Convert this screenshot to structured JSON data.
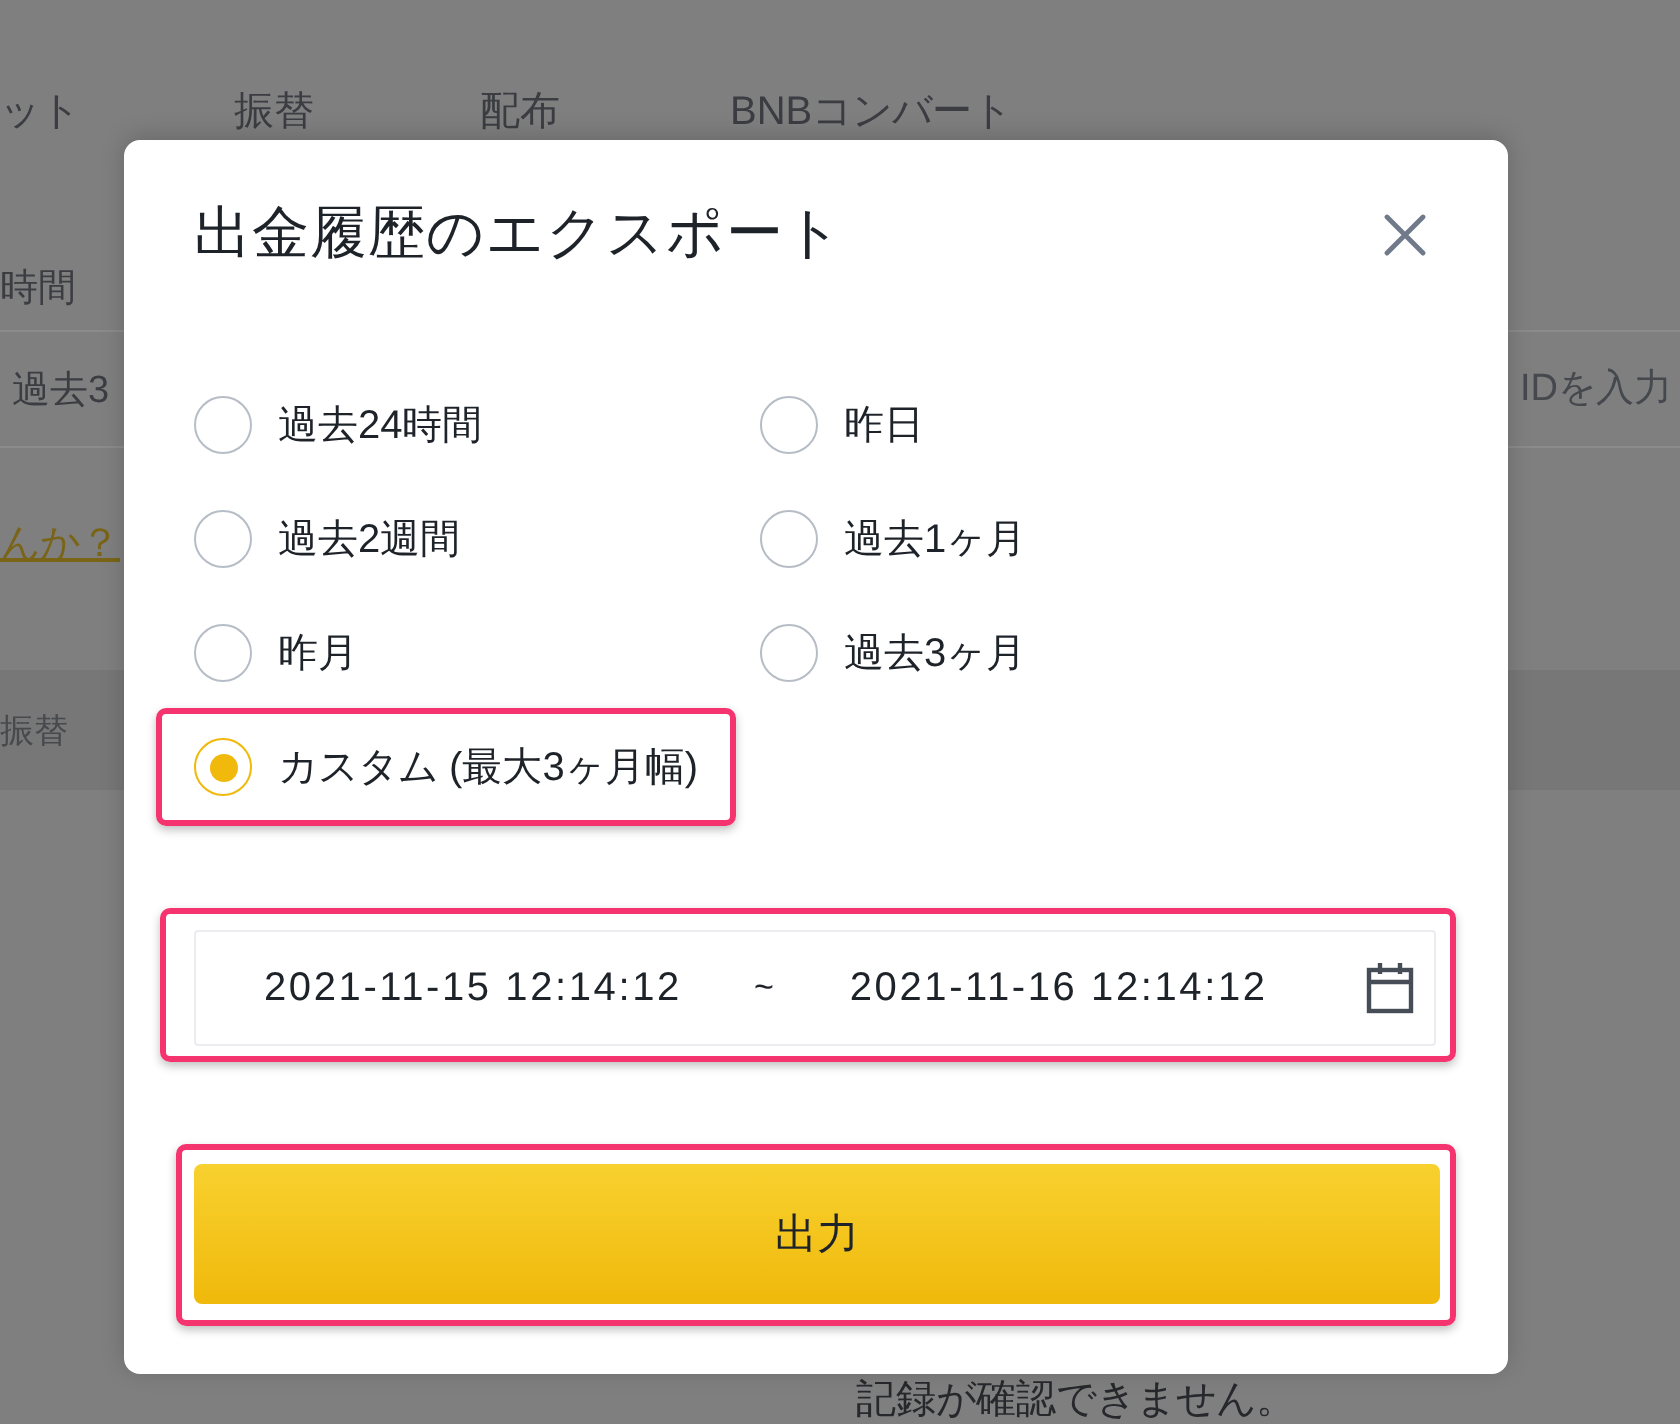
{
  "background": {
    "tabs": [
      {
        "label": "ット"
      },
      {
        "label": "振替"
      },
      {
        "label": "配布"
      },
      {
        "label": "BNBコンバート"
      }
    ],
    "time_label": "時間",
    "period_field": {
      "value": "過去3"
    },
    "id_field": {
      "placeholder": "IDを入力"
    },
    "help_link": "んか？",
    "table_header": {
      "column_1": "振替"
    },
    "empty_message": "記録が確認できません。"
  },
  "dialog": {
    "title": "出金履歴のエクスポート",
    "options": [
      {
        "label": "過去24時間",
        "selected": false,
        "highlighted": false
      },
      {
        "label": "昨日",
        "selected": false,
        "highlighted": false
      },
      {
        "label": "過去2週間",
        "selected": false,
        "highlighted": false
      },
      {
        "label": "過去1ヶ月",
        "selected": false,
        "highlighted": false
      },
      {
        "label": "昨月",
        "selected": false,
        "highlighted": false
      },
      {
        "label": "過去3ヶ月",
        "selected": false,
        "highlighted": false
      },
      {
        "label": "カスタム (最大3ヶ月幅)",
        "selected": true,
        "highlighted": true
      }
    ],
    "date_range": {
      "start": "2021-11-15 12:14:12",
      "separator": "~",
      "end": "2021-11-16 12:14:12",
      "highlighted": true
    },
    "export_button": {
      "label": "出力",
      "highlighted": true
    }
  }
}
